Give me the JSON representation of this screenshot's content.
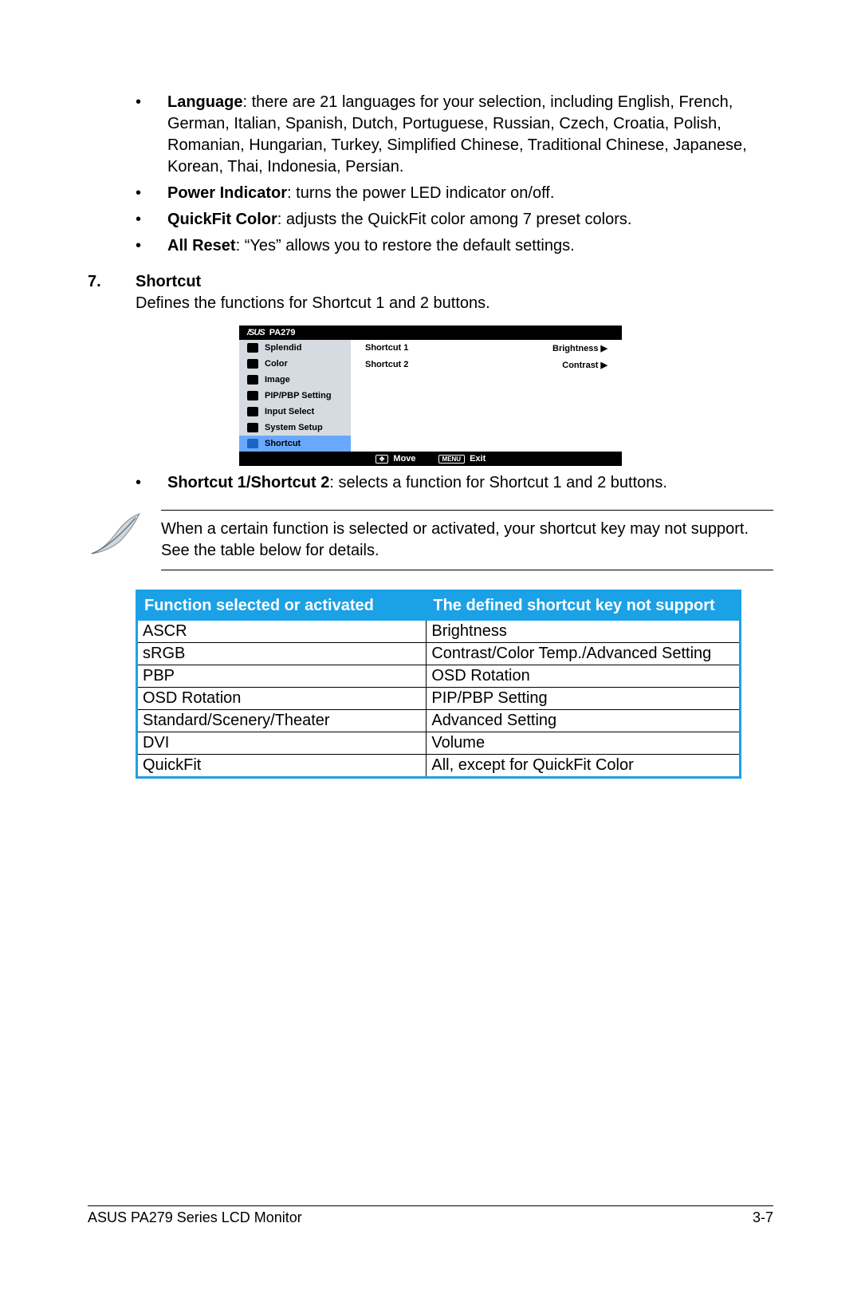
{
  "bullets": {
    "language": {
      "label": "Language",
      "text": ": there are 21 languages for your selection, including English, French, German, Italian, Spanish, Dutch, Portuguese, Russian, Czech, Croatia, Polish, Romanian, Hungarian, Turkey, Simplified Chinese, Traditional Chinese, Japanese, Korean, Thai, Indonesia, Persian."
    },
    "power": {
      "label": "Power Indicator",
      "text": ": turns the power LED indicator on/off."
    },
    "quickfit": {
      "label": "QuickFit Color",
      "text": ": adjusts the QuickFit color among 7 preset colors."
    },
    "reset": {
      "label": "All Reset",
      "text": ": “Yes” allows you to restore the default settings."
    }
  },
  "section": {
    "num": "7.",
    "title": "Shortcut",
    "desc": "Defines the functions for Shortcut 1 and 2 buttons."
  },
  "osd": {
    "logo": "/SUS",
    "model": "PA279",
    "side": [
      "Splendid",
      "Color",
      "Image",
      "PIP/PBP Setting",
      "Input Select",
      "System Setup",
      "Shortcut"
    ],
    "rows": [
      {
        "l": "Shortcut 1",
        "r": "Brightness  ▶"
      },
      {
        "l": "Shortcut 2",
        "r": "Contrast  ▶"
      }
    ],
    "bot": {
      "move": "Move",
      "exit": "Exit",
      "menu": "MENU"
    }
  },
  "sub_bullet": {
    "label": "Shortcut 1/Shortcut 2",
    "text": ": selects a function for Shortcut 1 and 2 buttons."
  },
  "note": "When a certain function is selected or activated, your shortcut key may not support. See the table below for details.",
  "table": {
    "h1": "Function selected or activated",
    "h2": "The defined shortcut key not support",
    "rows": [
      [
        "ASCR",
        "Brightness"
      ],
      [
        "sRGB",
        "Contrast/Color Temp./Advanced Setting"
      ],
      [
        "PBP",
        "OSD Rotation"
      ],
      [
        "OSD Rotation",
        "PIP/PBP Setting"
      ],
      [
        "Standard/Scenery/Theater",
        "Advanced Setting"
      ],
      [
        "DVI",
        "Volume"
      ],
      [
        "QuickFit",
        "All, except for QuickFit Color"
      ]
    ]
  },
  "footer": {
    "left": "ASUS PA279 Series LCD Monitor",
    "right": "3-7"
  }
}
